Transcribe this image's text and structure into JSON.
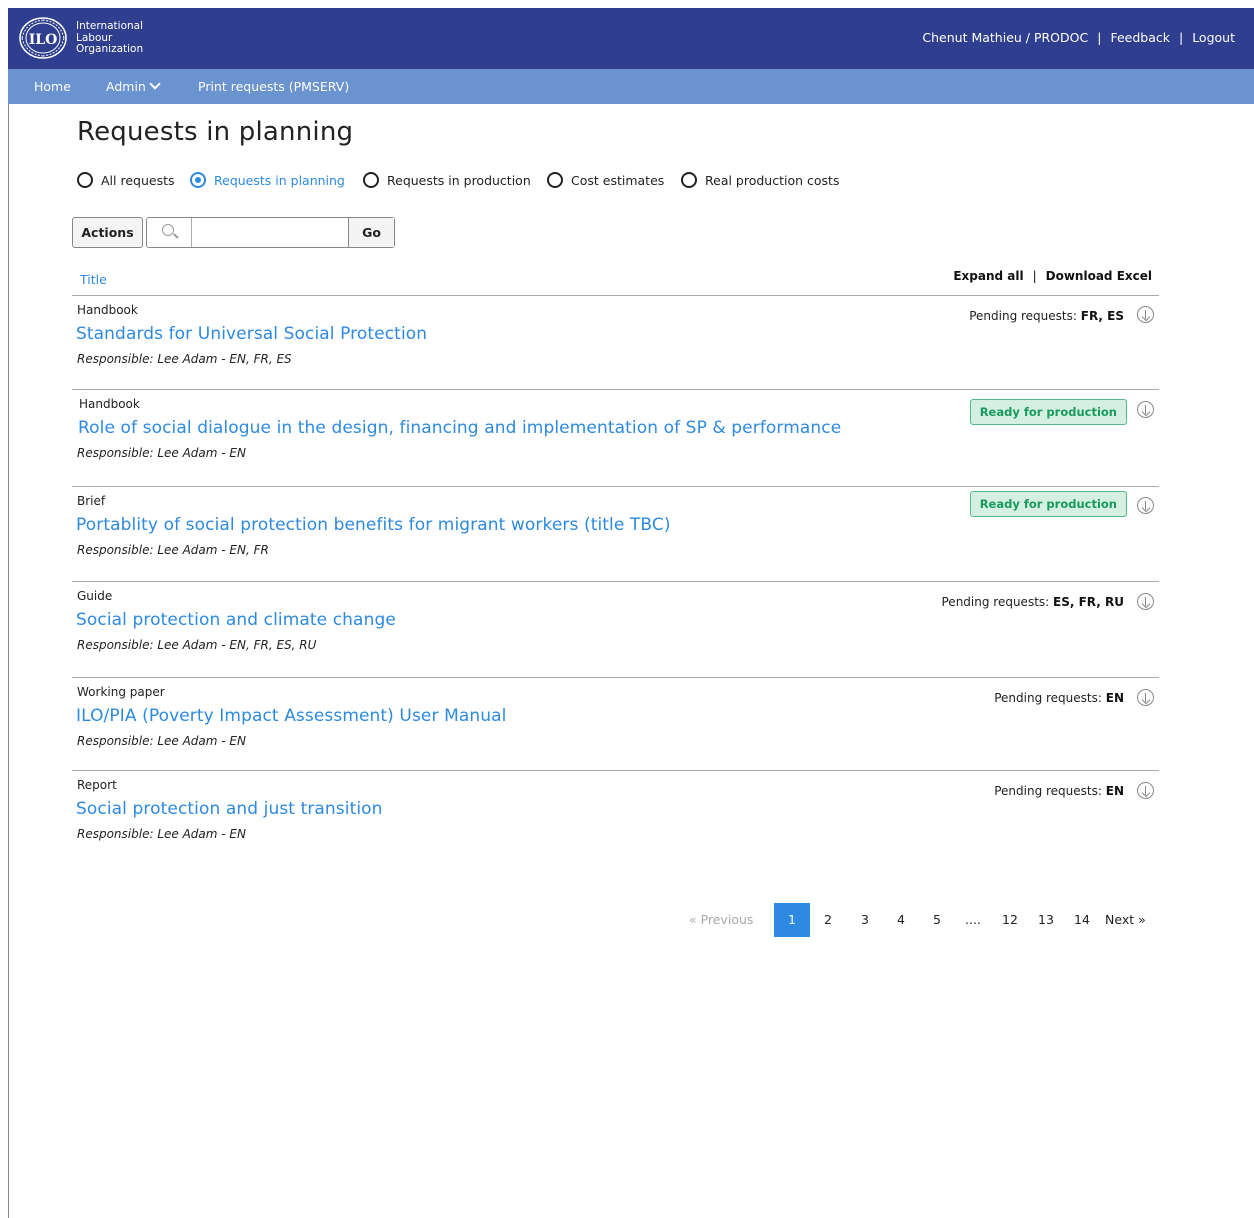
{
  "header": {
    "org_name": [
      "International",
      "Labour",
      "Organization"
    ],
    "logo_text": "ILO",
    "user": "Chenut Mathieu / PRODOC",
    "feedback": "Feedback",
    "logout": "Logout",
    "separator": "|"
  },
  "nav": {
    "home": "Home",
    "admin": "Admin",
    "print_requests": "Print requests (PMSERV)"
  },
  "page_title": "Requests in planning",
  "filters": {
    "all": "All requests",
    "planning": "Requests in planning",
    "production": "Requests in production",
    "cost_estimates": "Cost estimates",
    "real_costs": "Real production costs",
    "selected": "planning"
  },
  "toolbar": {
    "actions": "Actions",
    "search_value": "",
    "go": "Go"
  },
  "list": {
    "column_title": "Title",
    "expand_all": "Expand all",
    "separator": "|",
    "download_excel": "Download Excel",
    "items": [
      {
        "kind": "Handbook",
        "title": "Standards for Universal Social Protection",
        "responsible": "Responsible: Lee Adam - EN, FR, ES",
        "status_label": "Pending requests:",
        "status_value": "FR, ES",
        "badge": ""
      },
      {
        "kind": "Handbook",
        "title": "Role of social dialogue in the design, financing and implementation of SP & performance",
        "responsible": "Responsible: Lee Adam - EN",
        "status_label": "",
        "status_value": "",
        "badge": "Ready for production"
      },
      {
        "kind": "Brief",
        "title": "Portablity of social protection benefits for migrant workers (title TBC)",
        "responsible": "Responsible: Lee Adam - EN, FR",
        "status_label": "",
        "status_value": "",
        "badge": "Ready for production"
      },
      {
        "kind": "Guide",
        "title": "Social protection and climate change",
        "responsible": "Responsible: Lee Adam - EN, FR, ES, RU",
        "status_label": "Pending requests:",
        "status_value": "ES, FR, RU",
        "badge": ""
      },
      {
        "kind": "Working paper",
        "title": "ILO/PIA (Poverty Impact Assessment) User Manual",
        "responsible": "Responsible: Lee Adam - EN",
        "status_label": "Pending requests:",
        "status_value": "EN",
        "badge": ""
      },
      {
        "kind": "Report",
        "title": "Social protection and just transition",
        "responsible": "Responsible: Lee Adam - EN",
        "status_label": "Pending requests:",
        "status_value": "EN",
        "badge": ""
      }
    ]
  },
  "pagination": {
    "previous": "« Previous",
    "pages": [
      "1",
      "2",
      "3",
      "4",
      "5",
      "....",
      "12",
      "13",
      "14"
    ],
    "current": "1",
    "next": "Next »"
  },
  "colors": {
    "header_bg": "#2f3e8e",
    "nav_bg": "#6a93d0",
    "link": "#2d8ae0",
    "badge_bg": "#d5f0e2",
    "badge_text": "#199a5c"
  }
}
